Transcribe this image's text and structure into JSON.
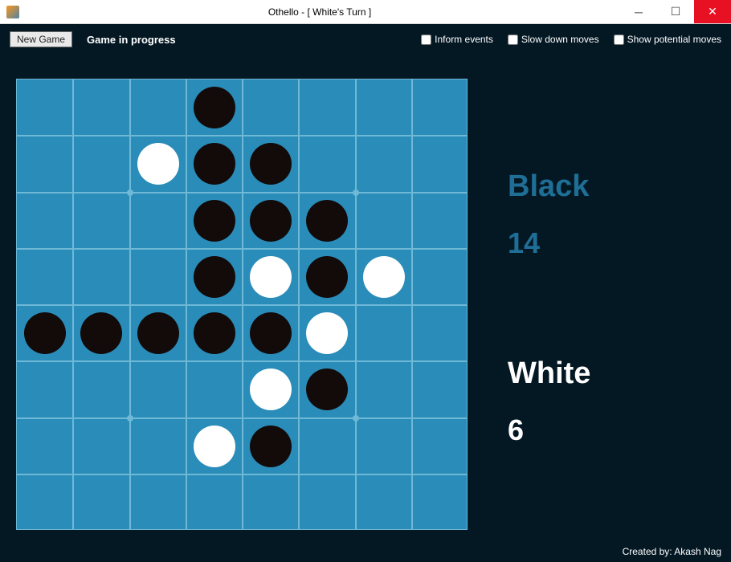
{
  "window": {
    "title": "Othello - [ White's Turn ]"
  },
  "toolbar": {
    "new_game_label": "New Game",
    "status": "Game in progress",
    "checkboxes": [
      {
        "label": "Inform events",
        "checked": false
      },
      {
        "label": "Slow down moves",
        "checked": false
      },
      {
        "label": "Show potential moves",
        "checked": false
      }
    ]
  },
  "board": {
    "size": 8,
    "cells": [
      [
        null,
        null,
        null,
        "B",
        null,
        null,
        null,
        null
      ],
      [
        null,
        null,
        "W",
        "B",
        "B",
        null,
        null,
        null
      ],
      [
        null,
        null,
        null,
        "B",
        "B",
        "B",
        null,
        null
      ],
      [
        null,
        null,
        null,
        "B",
        "W",
        "B",
        "W",
        null
      ],
      [
        "B",
        "B",
        "B",
        "B",
        "B",
        "W",
        null,
        null
      ],
      [
        null,
        null,
        null,
        null,
        "W",
        "B",
        null,
        null
      ],
      [
        null,
        null,
        null,
        "W",
        "B",
        null,
        null,
        null
      ],
      [
        null,
        null,
        null,
        null,
        null,
        null,
        null,
        null
      ]
    ],
    "guide_dots": [
      [
        2,
        2
      ],
      [
        2,
        6
      ],
      [
        6,
        2
      ],
      [
        6,
        6
      ]
    ]
  },
  "scores": {
    "black": {
      "label": "Black",
      "value": "14"
    },
    "white": {
      "label": "White",
      "value": "6"
    }
  },
  "credit": "Created by: Akash Nag"
}
